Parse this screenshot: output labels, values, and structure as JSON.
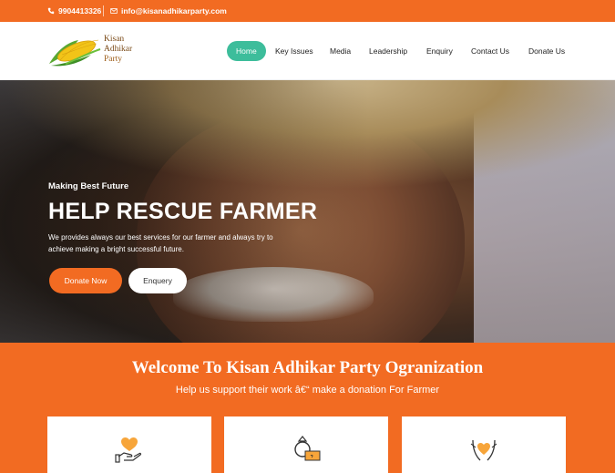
{
  "topbar": {
    "phone": "9904413326",
    "email": "info@kisanadhikarparty.com"
  },
  "logo": {
    "line1": "Kisan",
    "line2": "Adhikar",
    "line3": "Party"
  },
  "nav": {
    "items": [
      "Home",
      "Key Issues",
      "Media",
      "Leadership",
      "Enquiry",
      "Contact Us",
      "Donate Us"
    ],
    "active": "Home"
  },
  "hero": {
    "subtitle": "Making Best Future",
    "title": "HELP RESCUE FARMER",
    "description": "We provides always our best services for our farmer and always try to achieve making a bright successful future.",
    "donate_button": "Donate Now",
    "enquery_button": "Enquery"
  },
  "welcome": {
    "title": "Welcome To Kisan Adhikar Party Ogranization",
    "subtitle": "Help us support their work â€“ make a donation For Farmer"
  },
  "cards": [
    {
      "icon": "heart-hand-icon"
    },
    {
      "icon": "ring-money-icon"
    },
    {
      "icon": "heart-hands-icon"
    }
  ],
  "colors": {
    "orange": "#f26b22",
    "teal": "#3dbd9b"
  }
}
